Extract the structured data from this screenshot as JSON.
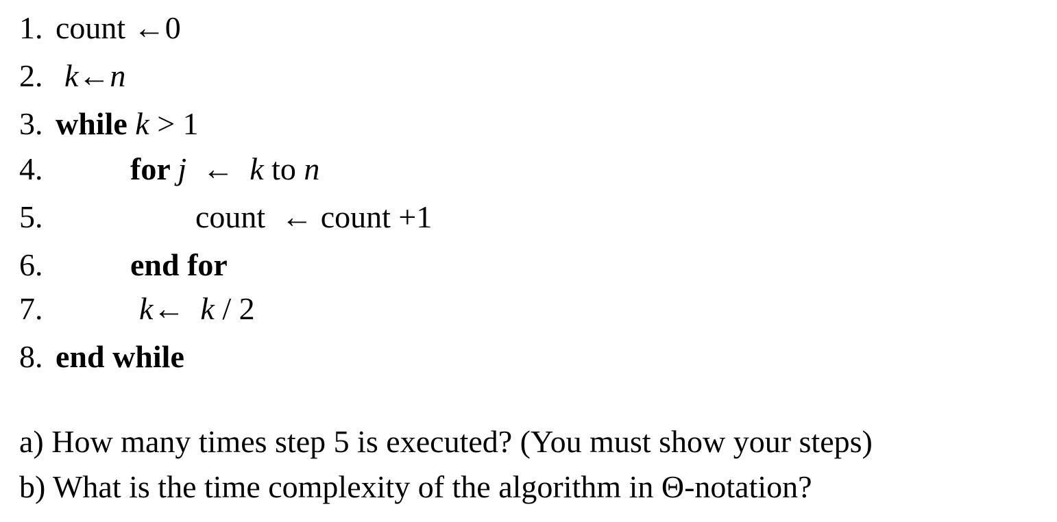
{
  "algorithm": {
    "lines": [
      {
        "num": "1.",
        "segments": [
          {
            "t": "count ",
            "s": ""
          },
          {
            "t": "←",
            "s": ""
          },
          {
            "t": "0",
            "s": ""
          }
        ]
      },
      {
        "num": "2.",
        "segments": [
          {
            "t": "k",
            "s": "i"
          },
          {
            "t": "←",
            "s": ""
          },
          {
            "t": "n",
            "s": "i"
          }
        ]
      },
      {
        "num": "3.",
        "segments": [
          {
            "t": "while ",
            "s": "b"
          },
          {
            "t": "k",
            "s": "i"
          },
          {
            "t": " > 1",
            "s": ""
          }
        ]
      },
      {
        "num": "4.",
        "segments": [
          {
            "t": "for ",
            "s": "b"
          },
          {
            "t": "j",
            "s": "i"
          },
          {
            "t": "  ←  ",
            "s": ""
          },
          {
            "t": "k",
            "s": "i"
          },
          {
            "t": " to ",
            "s": ""
          },
          {
            "t": "n",
            "s": "i"
          }
        ]
      },
      {
        "num": "5.",
        "segments": [
          {
            "t": "count  ",
            "s": ""
          },
          {
            "t": "←",
            "s": ""
          },
          {
            "t": " count +1",
            "s": ""
          }
        ]
      },
      {
        "num": "6.",
        "segments": [
          {
            "t": "end for",
            "s": "b"
          }
        ]
      },
      {
        "num": "7.",
        "segments": [
          {
            "t": "k",
            "s": "i"
          },
          {
            "t": "←  ",
            "s": ""
          },
          {
            "t": "k",
            "s": "i"
          },
          {
            "t": " / 2",
            "s": ""
          }
        ]
      },
      {
        "num": "8.",
        "segments": [
          {
            "t": "end while",
            "s": "b"
          }
        ]
      }
    ]
  },
  "questions": {
    "a": "a) How many times step 5 is executed? (You must show your steps)",
    "b": "b) What is the time complexity of the algorithm in Θ-notation?"
  }
}
